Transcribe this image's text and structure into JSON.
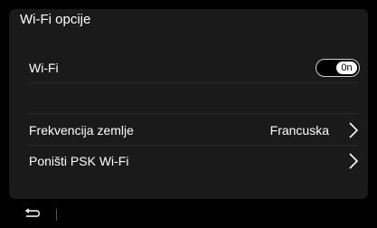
{
  "header": {
    "title": "Wi-Fi opcije"
  },
  "rows": [
    {
      "label": "Wi-Fi",
      "toggle": {
        "state": "On",
        "label": "0n"
      }
    },
    {
      "label": "Frekvencija zemlje",
      "value": "Francuska",
      "icon": "chevron-right-icon"
    },
    {
      "label": "Poništi PSK Wi-Fi",
      "icon": "chevron-right-icon"
    }
  ],
  "bottombar": {
    "back_icon": "back-arrow-icon"
  },
  "colors": {
    "background": "#000000",
    "panel": "#1a1a1a",
    "text": "#ffffff"
  }
}
